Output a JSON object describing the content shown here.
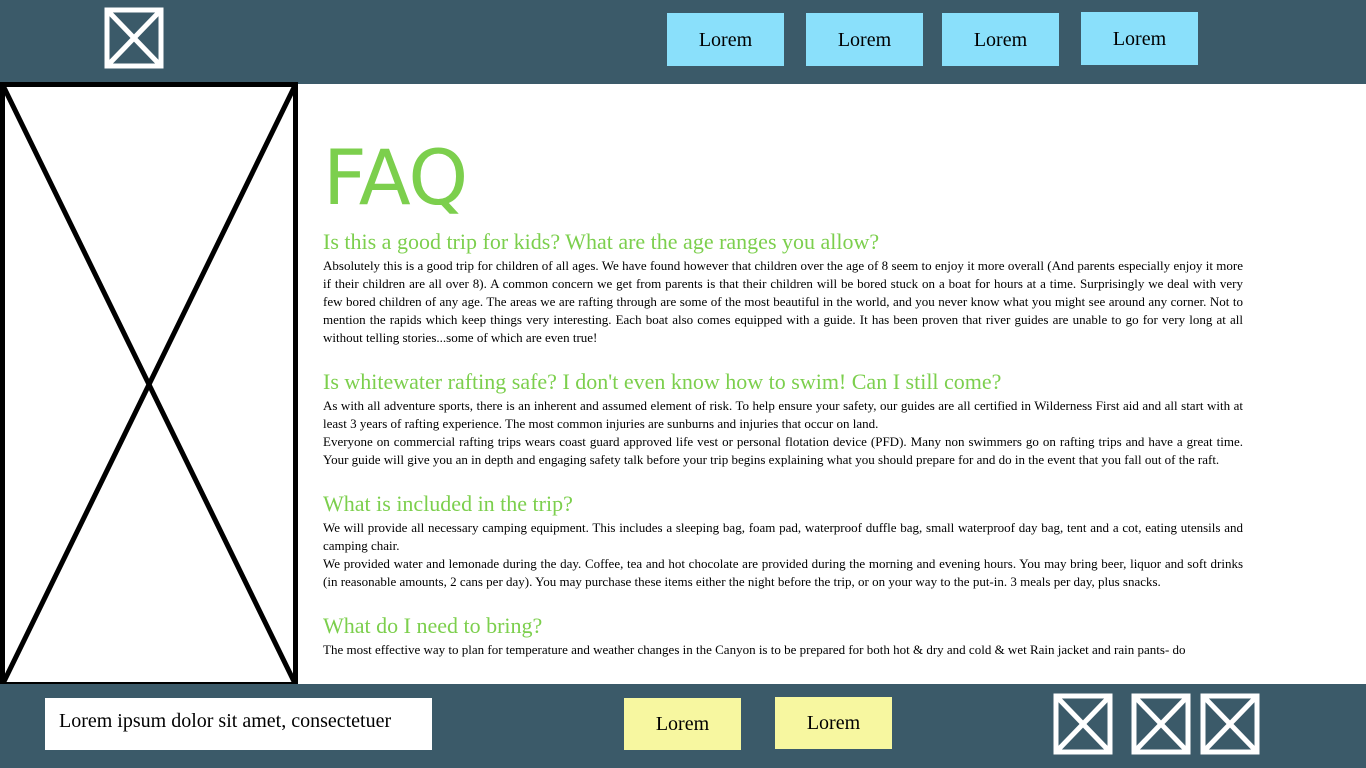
{
  "header": {
    "logo_icon": "image-placeholder-icon",
    "nav": [
      "Lorem",
      "Lorem",
      "Lorem",
      "Lorem"
    ],
    "nav_color": "#8ae0fb",
    "bar_color": "#3b5a69"
  },
  "sidebar": {
    "image_icon": "image-placeholder-icon"
  },
  "main": {
    "title": "FAQ",
    "accent_color": "#7ccf4d",
    "faq": [
      {
        "question": "Is this a good trip for kids? What are the age ranges you allow?",
        "answers": [
          "Absolutely this is a good trip for children of all ages. We have found however that children over the age of 8 seem to enjoy it more overall (And parents especially enjoy it more if their children are all over 8). A common concern we get from parents is that their children will be bored stuck on a boat for hours at a time. Surprisingly we deal with very few bored children of any age. The areas we are rafting through are some of the most beautiful in the world, and you never know what you might see around any corner. Not to mention the rapids which keep things very interesting. Each boat also comes equipped with a guide. It has been proven that river guides are unable to go for very long at all without telling stories...some of which are even true!"
        ]
      },
      {
        "question": "Is whitewater rafting safe? I don't even know how to swim! Can I still come?",
        "answers": [
          "As with all adventure sports, there is an inherent and assumed element of risk. To help ensure your safety, our guides are all certified in Wilderness First aid and all start with at least 3 years of rafting experience. The most common injuries are sunburns and injuries that occur on land.",
          "Everyone on commercial rafting trips wears coast guard approved life vest or personal flotation device (PFD). Many non swimmers go on rafting trips and have a great time. Your guide will give you an in depth and engaging safety talk before your trip begins explaining what you should prepare for and do in the event that you fall out of the raft."
        ]
      },
      {
        "question": "What is included in the trip?",
        "answers": [
          "We will provide all necessary camping equipment. This includes a sleeping bag, foam pad, waterproof duffle bag, small waterproof day bag, tent and a cot, eating utensils and camping chair.",
          "We provided water and lemonade during the day. Coffee, tea and hot chocolate are provided during the morning and evening hours. You may bring beer, liquor and soft drinks (in reasonable amounts, 2 cans per day). You may purchase these items either the night before the trip, or on your way to the put-in. 3 meals per day, plus snacks."
        ]
      },
      {
        "question": "What do I need to bring?",
        "answers": [
          "The most effective way to plan for temperature and weather changes in the Canyon is to be prepared for both hot & dry and cold & wet Rain jacket and rain pants- do"
        ]
      }
    ]
  },
  "footer": {
    "input_text": "Lorem ipsum dolor sit amet, consectetuer",
    "buttons": [
      "Lorem",
      "Lorem"
    ],
    "button_color": "#f7f7a0",
    "social_icons": [
      "image-placeholder-icon",
      "image-placeholder-icon",
      "image-placeholder-icon"
    ]
  }
}
